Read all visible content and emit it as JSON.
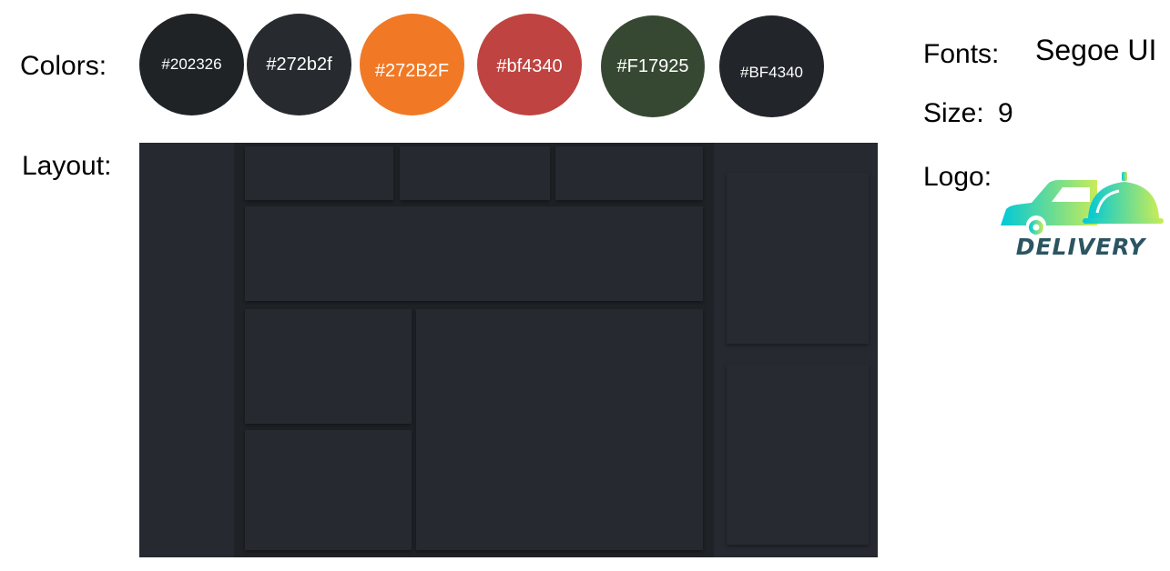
{
  "labels": {
    "colors": "Colors:",
    "layout": "Layout:",
    "fonts": "Fonts:",
    "size": "Size:",
    "logo": "Logo:"
  },
  "font_name": "Segoe UI",
  "font_size": "9",
  "swatches": [
    {
      "label": "#202326",
      "color": "#202326"
    },
    {
      "label": "#272b2f",
      "color": "#272b2f"
    },
    {
      "label": "#272B2F",
      "color": "#f17925"
    },
    {
      "label": "#bf4340",
      "color": "#bf4340"
    },
    {
      "label": "#F17925",
      "color": "#374832"
    },
    {
      "label": "#BF4340",
      "color": "#22252a"
    }
  ],
  "logo_text": "DELIVERY",
  "logo_colors": {
    "gradient_start": "#00c9d8",
    "gradient_end": "#c8ec58",
    "text": "#2b5561"
  }
}
